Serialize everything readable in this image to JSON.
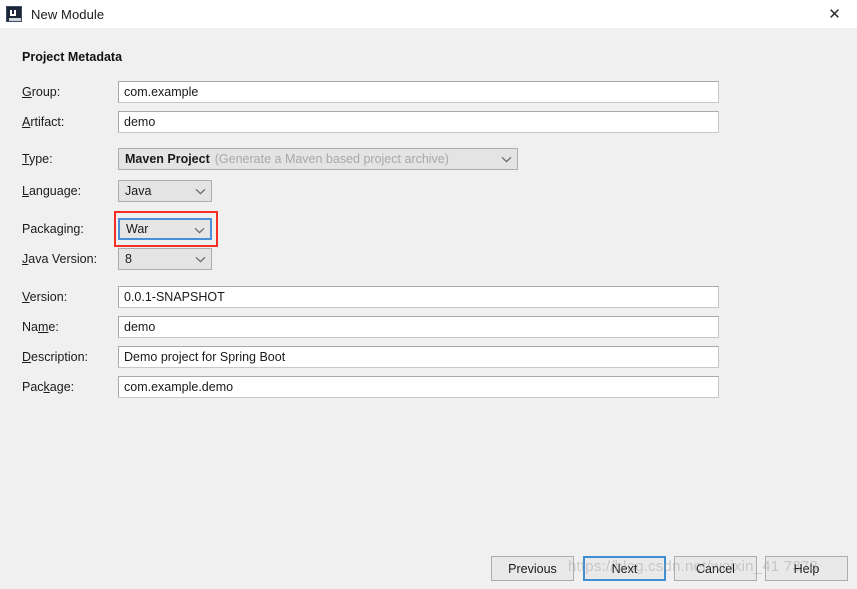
{
  "window": {
    "title": "New Module",
    "app_icon": "intellij-idea-logo-icon",
    "close_icon": "close-icon",
    "titlebar_bg": "#ffffff",
    "body_bg": "#f0f0f0"
  },
  "section": {
    "title": "Project Metadata"
  },
  "fields": {
    "group": {
      "label": "Group:",
      "mnemonic": "G",
      "value": "com.example",
      "type": "text"
    },
    "artifact": {
      "label": "Artifact:",
      "mnemonic": "A",
      "value": "demo",
      "type": "text"
    },
    "type": {
      "label": "Type:",
      "mnemonic": "T",
      "value": "Maven Project",
      "hint": "(Generate a Maven based project archive)",
      "type": "combobox",
      "disabled": true
    },
    "language": {
      "label": "Language:",
      "mnemonic": "L",
      "value": "Java",
      "type": "combobox"
    },
    "packaging": {
      "label": "Packaging:",
      "mnemonic": "g",
      "value": "War",
      "type": "combobox",
      "focused": true,
      "highlight_color": "#f52f23"
    },
    "java_version": {
      "label": "Java Version:",
      "mnemonic": "J",
      "value": "8",
      "type": "combobox"
    },
    "version": {
      "label": "Version:",
      "mnemonic": "V",
      "value": "0.0.1-SNAPSHOT",
      "type": "text"
    },
    "name": {
      "label": "Name:",
      "mnemonic": "m",
      "value": "demo",
      "type": "text"
    },
    "description": {
      "label": "Description:",
      "mnemonic": "D",
      "value": "Demo project for Spring Boot",
      "type": "text"
    },
    "package": {
      "label": "Package:",
      "mnemonic": "k",
      "value": "com.example.demo",
      "type": "text"
    }
  },
  "buttons": {
    "previous": "Previous",
    "next": "Next",
    "cancel": "Cancel",
    "help": "Help",
    "focused": "Next",
    "focus_color": "#3f8fd4"
  },
  "watermark": {
    "text": "https://blog.csdn.net/weixin_41  7378"
  },
  "icons": {
    "chevron_down": "chevron-down-icon"
  }
}
